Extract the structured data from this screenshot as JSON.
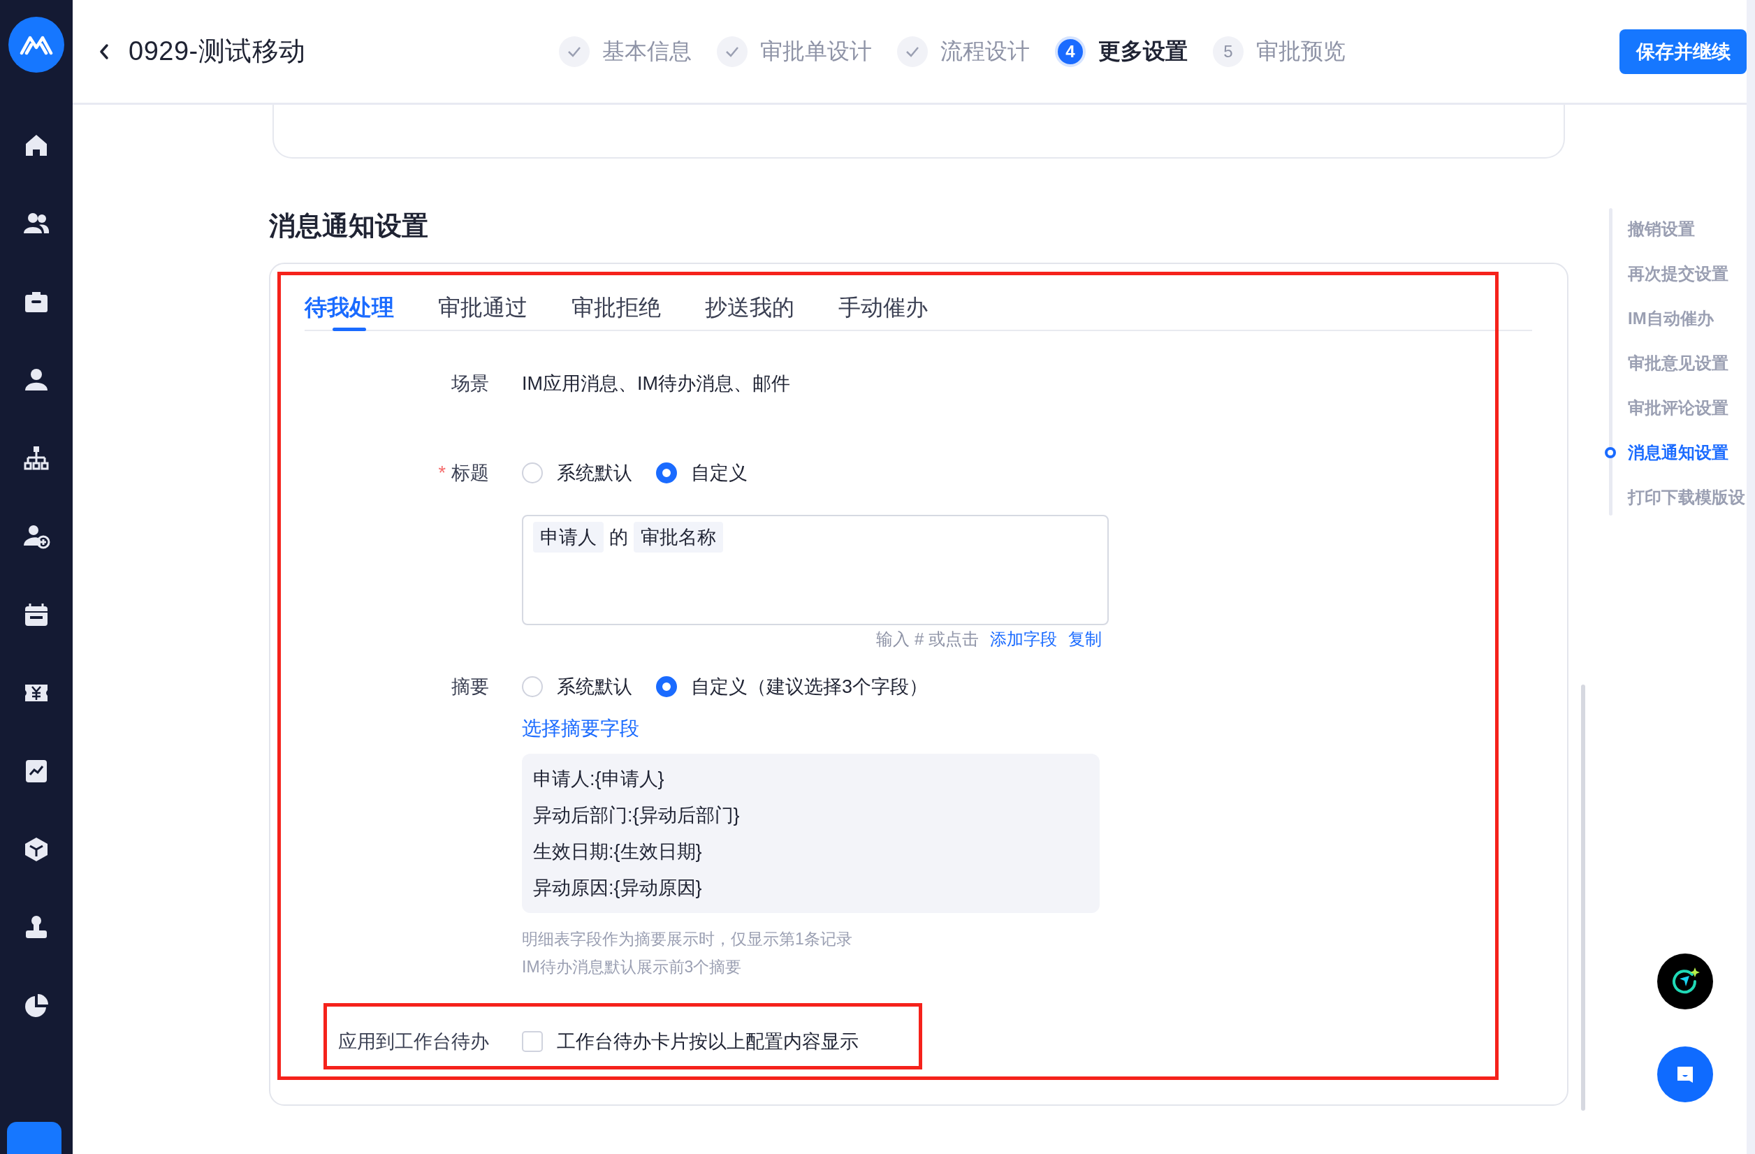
{
  "header": {
    "title": "0929-测试移动",
    "steps": [
      {
        "kind": "done",
        "label": "基本信息"
      },
      {
        "kind": "done",
        "label": "审批单设计"
      },
      {
        "kind": "done",
        "label": "流程设计"
      },
      {
        "kind": "current",
        "number": "4",
        "label": "更多设置"
      },
      {
        "kind": "todo",
        "number": "5",
        "label": "审批预览"
      }
    ],
    "primary_button": "保存并继续"
  },
  "section_title": "消息通知设置",
  "tabs": [
    {
      "label": "待我处理",
      "selected": true
    },
    {
      "label": "审批通过",
      "selected": false
    },
    {
      "label": "审批拒绝",
      "selected": false
    },
    {
      "label": "抄送我的",
      "selected": false
    },
    {
      "label": "手动催办",
      "selected": false
    }
  ],
  "form": {
    "scene": {
      "label": "场景",
      "value": "IM应用消息、IM待办消息、邮件"
    },
    "title": {
      "required_mark": "*",
      "label": "标题",
      "options": [
        {
          "label": "系统默认",
          "selected": false
        },
        {
          "label": "自定义",
          "selected": true
        }
      ],
      "tokens": [
        {
          "kind": "field",
          "text": "申请人"
        },
        {
          "kind": "text",
          "text": "的"
        },
        {
          "kind": "field",
          "text": "审批名称"
        }
      ],
      "helper": "输入 # 或点击",
      "links": [
        "添加字段",
        "复制"
      ]
    },
    "summary": {
      "label": "摘要",
      "options": [
        {
          "label": "系统默认",
          "selected": false
        },
        {
          "label": "自定义（建议选择3个字段）",
          "selected": true
        }
      ],
      "link": "选择摘要字段",
      "lines": [
        "申请人:{申请人}",
        "异动后部门:{异动后部门}",
        "生效日期:{生效日期}",
        "异动原因:{异动原因}"
      ],
      "hints": [
        "明细表字段作为摘要展示时，仅显示第1条记录",
        "IM待办消息默认展示前3个摘要"
      ]
    },
    "apply": {
      "label": "应用到工作台待办",
      "checked": false,
      "text": "工作台待办卡片按以上配置内容显示"
    }
  },
  "anchor_nav": {
    "items": [
      {
        "label": "撤销设置",
        "selected": false
      },
      {
        "label": "再次提交设置",
        "selected": false
      },
      {
        "label": "IM自动催办",
        "selected": false
      },
      {
        "label": "审批意见设置",
        "selected": false
      },
      {
        "label": "审批评论设置",
        "selected": false
      },
      {
        "label": "消息通知设置",
        "selected": true
      },
      {
        "label": "打印下载模版设",
        "selected": false
      }
    ]
  }
}
